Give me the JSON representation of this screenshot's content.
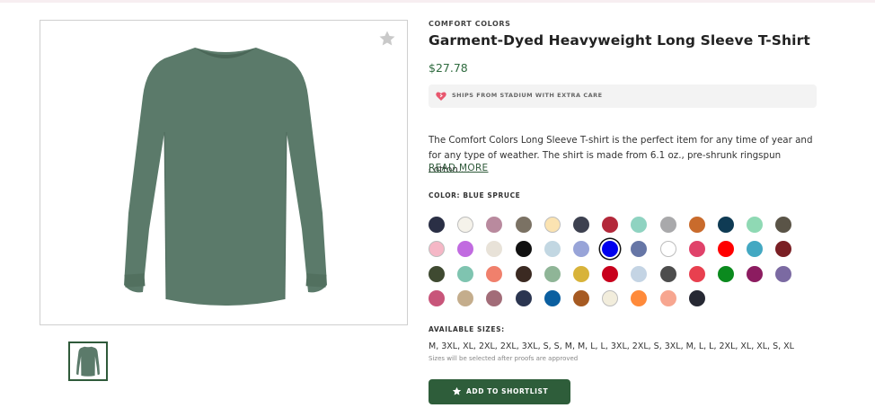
{
  "product": {
    "brand": "COMFORT COLORS",
    "title": "Garment-Dyed Heavyweight Long Sleeve T-Shirt",
    "price": "$27.78",
    "shipping_note": "SHIPS FROM STADIUM WITH EXTRA CARE",
    "description": "The Comfort Colors Long Sleeve T-shirt is the perfect item for any time of year and for any type of weather. The shirt is made from 6.1 oz., pre-shrunk ringspun cotton....",
    "read_more": "READ MORE",
    "color_label": "COLOR: BLUE SPRUCE",
    "sizes_label": "AVAILABLE SIZES:",
    "sizes": "M, 3XL, XL, 2XL, 2XL, 3XL, S, S, M, M, L, L, 3XL, 2XL, S, 3XL, M, L, L, 2XL, XL, XL, S, XL",
    "sizes_note": "Sizes will be selected after proofs are approved",
    "shortlist_button": "ADD TO SHORTLIST",
    "shirt_color": "#5b7a6a"
  },
  "icons": {
    "favorite": "star-icon",
    "shipping": "heart-icon",
    "button": "star-icon"
  },
  "colors": {
    "accent_green": "#2e5d3a",
    "price_green": "#2f6b3f"
  },
  "swatches": [
    "#2a2f45",
    "#f5f2ea",
    "#b98a9e",
    "#7b7264",
    "#fbe3b1",
    "#3d4150",
    "#b3283a",
    "#8fd3c1",
    "#a9a9ab",
    "#c96b2c",
    "#0f3b54",
    "#8fd9b4",
    "#5a5447",
    "#f5b7c6",
    "#c16be0",
    "#e8e2d8",
    "#111111",
    "#c2d7e2",
    "#98a4d8",
    "#0000ee",
    "#6676a6",
    "#ffffff",
    "#e0426a",
    "#ff0000",
    "#43a8c2",
    "#7a1f24",
    "#3f4a31",
    "#7fc4b0",
    "#f0806c",
    "#3b2a22",
    "#8fb597",
    "#d8b33a",
    "#c8001c",
    "#c4d4e4",
    "#4d4d4d",
    "#e8404f",
    "#0b8a1e",
    "#8c1c60",
    "#7b6aa2",
    "#c8557a",
    "#c4ad8c",
    "#a26c78",
    "#2b3550",
    "#0b5fa0",
    "#a65a22",
    "#f2eddc",
    "#ff8a3a",
    "#f7a690",
    "#262833"
  ],
  "selected_swatch": 19,
  "light_swatches": [
    1,
    4,
    13,
    21,
    45
  ]
}
